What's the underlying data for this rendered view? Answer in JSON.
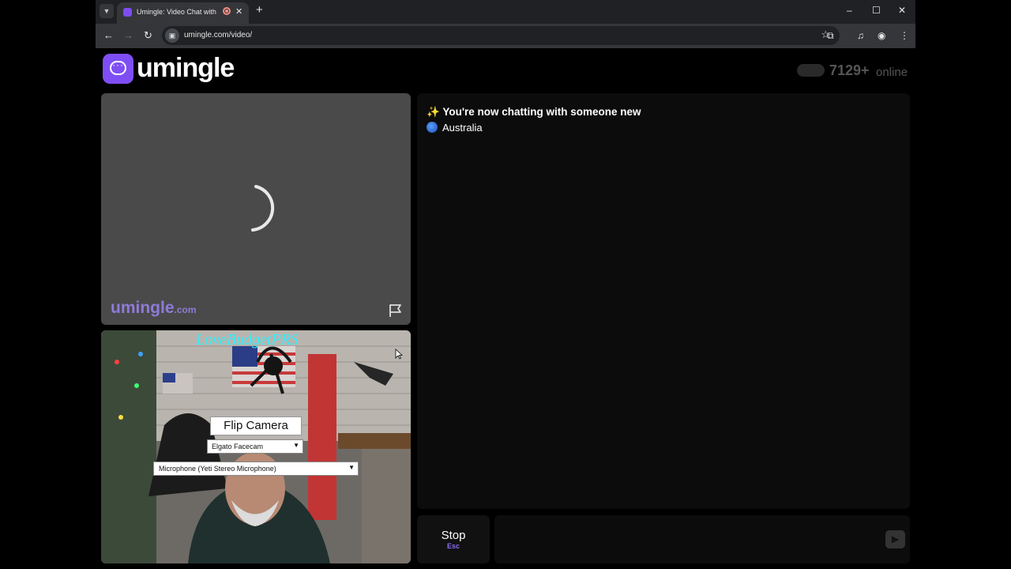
{
  "browser": {
    "tab_title": "Umingle: Video Chat with S",
    "tab_close": "✕",
    "new_tab": "+",
    "url": "umingle.com/video/",
    "window_controls": {
      "minimize": "–",
      "maximize": "☐",
      "close": "✕"
    },
    "icons": [
      "back-icon",
      "forward-icon",
      "reload-icon",
      "site-info-icon",
      "bookmark-star-icon",
      "extensions-icon",
      "media-control-icon",
      "profile-icon",
      "menu-icon"
    ]
  },
  "header": {
    "logo_text": "umingle",
    "online_count": "7129+",
    "online_label": "online"
  },
  "stranger_video": {
    "watermark_main": "umingle",
    "watermark_tld": ".com"
  },
  "self_video": {
    "flip_camera_label": "Flip Camera",
    "camera_selected": "Elgato Facecam",
    "microphone_selected": "Microphone (Yeti Stereo Microphone)"
  },
  "chat": {
    "status_emoji": "✨",
    "status_text": "You're now chatting with someone new",
    "country": "Australia"
  },
  "controls": {
    "stop_label": "Stop",
    "stop_hint": "Esc",
    "send_icon": "send-icon"
  },
  "colors": {
    "brand": "#7e4ef4",
    "page_bg": "#000000",
    "panel_bg": "#0c0c0c",
    "accent_text": "#8a6df0"
  }
}
